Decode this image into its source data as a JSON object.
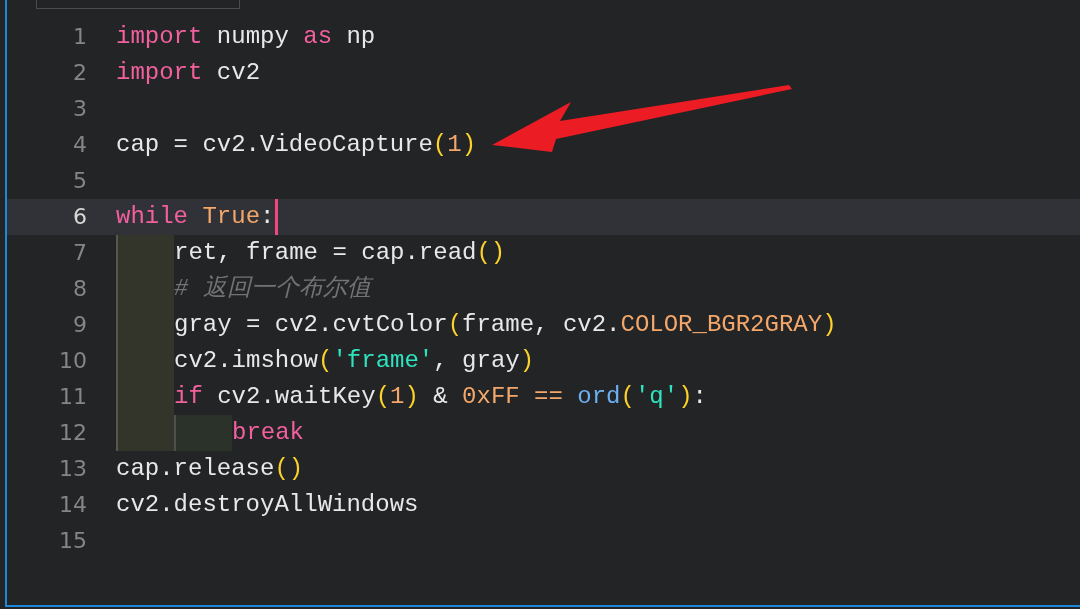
{
  "editor": {
    "lines": [
      {
        "number": "1",
        "selected": false,
        "tokens": [
          {
            "kind": "keyword",
            "text": "import"
          },
          {
            "kind": "plain",
            "text": " numpy "
          },
          {
            "kind": "keyword",
            "text": "as"
          },
          {
            "kind": "plain",
            "text": " np"
          }
        ]
      },
      {
        "number": "2",
        "selected": false,
        "tokens": [
          {
            "kind": "keyword",
            "text": "import"
          },
          {
            "kind": "plain",
            "text": " cv2"
          }
        ]
      },
      {
        "number": "3",
        "selected": false
      },
      {
        "number": "4",
        "selected": false,
        "tokens": [
          {
            "kind": "plain",
            "text": "cap = cv2.VideoCapture"
          },
          {
            "kind": "paren",
            "text": "("
          },
          {
            "kind": "constant",
            "text": "1"
          },
          {
            "kind": "paren",
            "text": ")"
          }
        ]
      },
      {
        "number": "5",
        "selected": false
      },
      {
        "number": "6",
        "selected": true,
        "tokens": [
          {
            "kind": "keyword",
            "text": "while"
          },
          {
            "kind": "constant",
            "text": " True"
          },
          {
            "kind": "plain",
            "text": ":"
          }
        ],
        "children": [
          {
            "number": "7",
            "selected": false,
            "tokens": [
              {
                "kind": "plain",
                "text": "ret, frame = cap.read"
              },
              {
                "kind": "paren",
                "text": "()"
              }
            ]
          },
          {
            "number": "8",
            "selected": false,
            "tokens": [
              {
                "kind": "comment",
                "text": "# 返回一个布尔值"
              }
            ]
          },
          {
            "number": "9",
            "selected": false,
            "tokens": [
              {
                "kind": "plain",
                "text": "gray = cv2.cvtColor"
              },
              {
                "kind": "paren",
                "text": "("
              },
              {
                "kind": "plain",
                "text": "frame, cv2."
              },
              {
                "kind": "constant",
                "text": "COLOR_BGR2GRAY"
              },
              {
                "kind": "paren",
                "text": ")"
              }
            ]
          },
          {
            "number": "10",
            "selected": false,
            "tokens": [
              {
                "kind": "plain",
                "text": "cv2.imshow"
              },
              {
                "kind": "paren",
                "text": "("
              },
              {
                "kind": "string",
                "text": "'frame'"
              },
              {
                "kind": "plain",
                "text": ", gray"
              },
              {
                "kind": "paren",
                "text": ")"
              }
            ]
          },
          {
            "number": "11",
            "selected": false,
            "tokens": [
              {
                "kind": "keyword",
                "text": "if"
              },
              {
                "kind": "plain",
                "text": " cv2.waitKey"
              },
              {
                "kind": "paren",
                "text": "("
              },
              {
                "kind": "constant",
                "text": "1"
              },
              {
                "kind": "paren",
                "text": ")"
              },
              {
                "kind": "plain",
                "text": " & "
              },
              {
                "kind": "constant",
                "text": "0xFF =="
              },
              {
                "kind": "builtin",
                "text": " ord"
              },
              {
                "kind": "paren",
                "text": "("
              },
              {
                "kind": "string",
                "text": "'q'"
              },
              {
                "kind": "paren",
                "text": ")"
              },
              {
                "kind": "plain",
                "text": ":"
              }
            ],
            "children": [
              {
                "number": "12",
                "selected": false,
                "tokens": [
                  {
                    "kind": "keyword",
                    "text": "break"
                  }
                ]
              }
            ]
          }
        ]
      },
      {
        "number": "13",
        "selected": false,
        "tokens": [
          {
            "kind": "plain",
            "text": "cap.release"
          },
          {
            "kind": "paren",
            "text": "()"
          }
        ]
      },
      {
        "number": "14",
        "selected": false,
        "tokens": [
          {
            "kind": "plain",
            "text": "cv2.destroyAllWindows"
          }
        ]
      },
      {
        "number": "15",
        "selected": false
      }
    ]
  }
}
